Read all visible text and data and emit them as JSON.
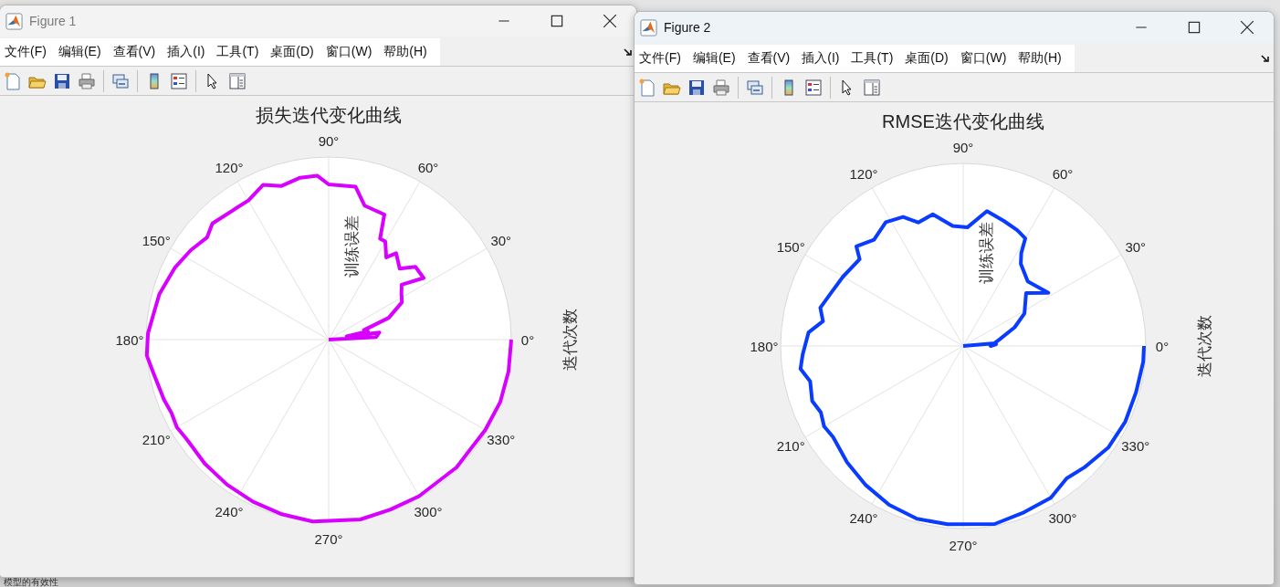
{
  "windows": [
    {
      "title": "Figure 1",
      "active": false,
      "menu": [
        "文件(F)",
        "编辑(E)",
        "查看(V)",
        "插入(I)",
        "工具(T)",
        "桌面(D)",
        "窗口(W)",
        "帮助(H)"
      ],
      "plot": {
        "title": "损失迭代变化曲线",
        "radial_label": "训练误差",
        "angular_label": "迭代次数",
        "angle_labels": [
          "0°",
          "30°",
          "60°",
          "90°",
          "120°",
          "150°",
          "180°",
          "210°",
          "240°",
          "270°",
          "300°",
          "330°"
        ],
        "color": "#d800ff"
      }
    },
    {
      "title": "Figure 2",
      "active": true,
      "menu": [
        "文件(F)",
        "编辑(E)",
        "查看(V)",
        "插入(I)",
        "工具(T)",
        "桌面(D)",
        "窗口(W)",
        "帮助(H)"
      ],
      "plot": {
        "title": "RMSE迭代变化曲线",
        "radial_label": "训练误差",
        "angular_label": "迭代次数",
        "angle_labels": [
          "0°",
          "30°",
          "60°",
          "90°",
          "120°",
          "150°",
          "180°",
          "210°",
          "240°",
          "270°",
          "300°",
          "330°"
        ],
        "color": "#0a3cff"
      }
    }
  ],
  "background_text": "模型的有效性"
}
